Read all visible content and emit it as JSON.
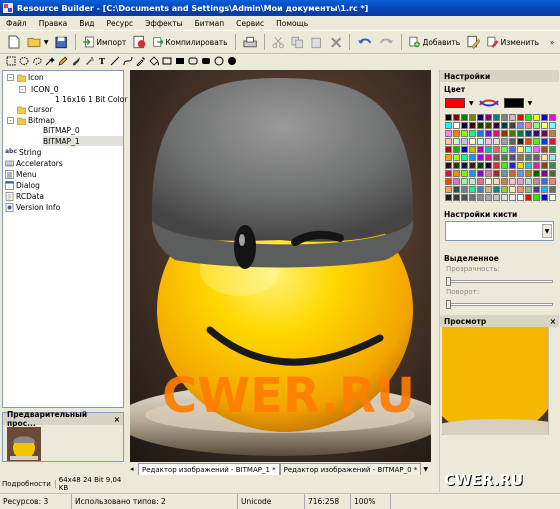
{
  "window": {
    "title": "Resource Builder - [C:\\Documents and Settings\\Admin\\Мои документы\\1.rc *]"
  },
  "menu": [
    "Файл",
    "Правка",
    "Вид",
    "Ресурс",
    "Эффекты",
    "Битмап",
    "Сервис",
    "Помощь"
  ],
  "toolbar": {
    "import": "Импорт",
    "compile": "Компилировать",
    "add": "Добавить",
    "edit": "Изменить"
  },
  "tree": {
    "icon": "Icon",
    "icon_0": "ICON_0",
    "icon_format": "1 16x16 1 Bit Color",
    "cursor": "Cursor",
    "bitmap": "Bitmap",
    "bitmap_0": "BITMAP_0",
    "bitmap_1": "BITMAP_1",
    "string": "String",
    "accelerators": "Accelerators",
    "menu": "Menu",
    "dialog": "Dialog",
    "rcdata": "RCData",
    "versioninfo": "Version Info"
  },
  "preview_panel": {
    "title": "Предварительный прос...",
    "close": "×"
  },
  "editor_tabs": [
    "Редактор изображений - BITMAP_1 *",
    "Редактор изображений - BITMAP_0 *"
  ],
  "left_info": {
    "label": "Подробности",
    "value": "64x48 24 Bit 9,04 KB"
  },
  "right_panel": {
    "settings_title": "Настройки",
    "color_title": "Цвет",
    "brush_title": "Настройки кисти",
    "selection_title": "Выделенное",
    "transparency_label": "Прозрачность:",
    "rotation_label": "Поворот:",
    "preview_title": "Просмотр",
    "preview_close": "×"
  },
  "colors": {
    "primary": "#ff0000",
    "secondary": "#000000",
    "palette": [
      "#000000",
      "#800000",
      "#008000",
      "#808000",
      "#000080",
      "#800080",
      "#008080",
      "#808080",
      "#c0c0c0",
      "#ff0000",
      "#00ff00",
      "#ffff00",
      "#0000ff",
      "#ff00ff",
      "#00ffff",
      "#ffffff",
      "#000040",
      "#400000",
      "#004000",
      "#404000",
      "#400040",
      "#004040",
      "#404040",
      "#8080ff",
      "#ff8080",
      "#80ff80",
      "#ffff80",
      "#80ffff",
      "#ff80ff",
      "#ff8000",
      "#80ff00",
      "#00ff80",
      "#0080ff",
      "#8000ff",
      "#ff0080",
      "#804000",
      "#408000",
      "#008040",
      "#004080",
      "#400080",
      "#800040",
      "#c08040",
      "#ffc0c0",
      "#c0ffc0",
      "#c0c0ff",
      "#ffffc0",
      "#c0ffff",
      "#ffc0ff",
      "#e0e0e0",
      "#a0a0a0",
      "#606060",
      "#202020",
      "#ff4000",
      "#40ff00",
      "#0040ff",
      "#ff0040",
      "#c00000",
      "#00c000",
      "#0000c0",
      "#c0c000",
      "#c000c0",
      "#00c0c0",
      "#ff6060",
      "#60ff60",
      "#6060ff",
      "#ffff60",
      "#60ffff",
      "#ff60ff",
      "#a05020",
      "#20a050",
      "#ffa000",
      "#a0ff00",
      "#00ffa0",
      "#00a0ff",
      "#a000ff",
      "#ff00a0",
      "#805050",
      "#508050",
      "#505080",
      "#808050",
      "#508080",
      "#805080",
      "#ffe0a0",
      "#a0e0ff",
      "#400020",
      "#204000",
      "#002040",
      "#402000",
      "#004020",
      "#200040",
      "#ff2020",
      "#20ff20",
      "#2020ff",
      "#ffd700",
      "#00ced1",
      "#ff1493",
      "#8b4513",
      "#2e8b57",
      "#dc143c",
      "#ff8c00",
      "#7cfc00",
      "#1e90ff",
      "#9400d3",
      "#ff69b4",
      "#a52a2a",
      "#5f9ea0",
      "#d2691e",
      "#6495ed",
      "#b8860b",
      "#006400",
      "#8b008b",
      "#556b2f",
      "#ff4500",
      "#da70d6",
      "#98fb98",
      "#afeeee",
      "#db7093",
      "#ffefd5",
      "#ffdab9",
      "#cd853f",
      "#ffc0cb",
      "#dda0dd",
      "#b0e0e6",
      "#bc8f8f",
      "#4169e1",
      "#fa8072",
      "#f4a460",
      "#2f4f4f",
      "#708090",
      "#00fa9a",
      "#4682b4",
      "#d2b48c",
      "#008b8b",
      "#9acd32",
      "#ffe4b5",
      "#e9967a",
      "#8fbc8f",
      "#483d8b",
      "#00bfff",
      "#696969",
      "#1c1c1c",
      "#383838",
      "#545454",
      "#707070",
      "#8c8c8c",
      "#a8a8a8",
      "#c4c4c4",
      "#e0e0e0",
      "#ececec",
      "#f8f8f8",
      "#ff0000",
      "#00ff00",
      "#0000ff",
      "#ffffff"
    ]
  },
  "status": {
    "resources": "Ресурсов: 3",
    "types": "Использовано типов: 2",
    "encoding": "Unicode",
    "coords": "716:258",
    "zoom": "100%"
  },
  "watermark": {
    "text": "CWER.RU"
  }
}
